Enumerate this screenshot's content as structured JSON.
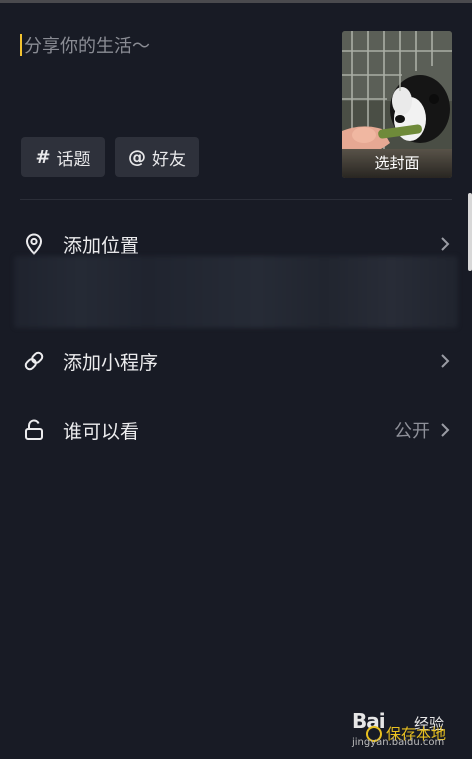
{
  "caption": {
    "placeholder": "分享你的生活～"
  },
  "cover": {
    "label": "选封面"
  },
  "tags": [
    {
      "symbol": "#",
      "label": "话题"
    },
    {
      "symbol": "@",
      "label": "好友"
    }
  ],
  "settings": {
    "location": {
      "label": "添加位置",
      "icon": "location-pin-icon"
    },
    "mini_program": {
      "label": "添加小程序",
      "icon": "link-icon"
    },
    "visibility": {
      "label": "谁可以看",
      "value": "公开",
      "icon": "unlock-icon"
    }
  },
  "watermark": {
    "brand": "Bai",
    "product": "经验",
    "url": "jingyan.baidu.com",
    "save": "保存本地"
  },
  "colors": {
    "background": "#181b25",
    "cursor": "#f2c230",
    "tag_bg": "#2e313b",
    "placeholder": "#8a8c94"
  }
}
